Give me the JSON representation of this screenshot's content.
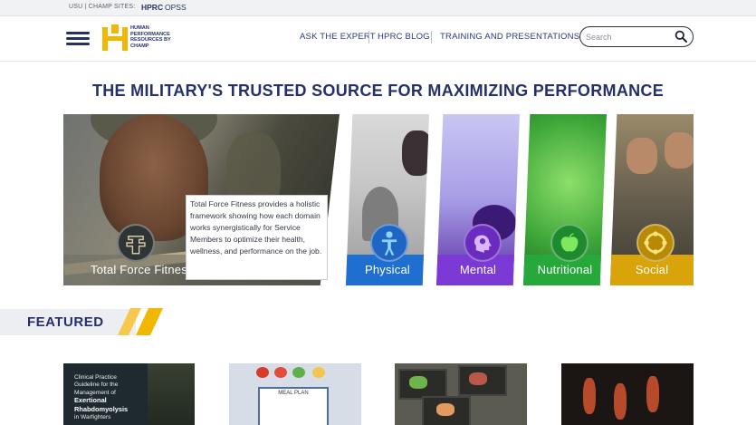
{
  "topbar": {
    "label": "USU | CHAMP SITES:",
    "links": [
      "HPRC",
      "OPSS"
    ]
  },
  "header": {
    "logo_text": "HUMAN PERFORMANCE RESOURCES BY CHAMP",
    "nav": [
      "ASK THE EXPERT",
      "HPRC BLOG",
      "TRAINING AND PRESENTATIONS"
    ],
    "search_placeholder": "Search"
  },
  "headline": "THE MILITARY'S TRUSTED SOURCE FOR MAXIMIZING PERFORMANCE",
  "hero": {
    "main_label": "Total Force Fitness",
    "tooltip": "Total Force Fitness provides a holistic framework showing how each domain works synergistically for Service Members to optimize their health, wellness, and performance on the job.",
    "tiles": [
      {
        "label": "Physical",
        "icon": "person-icon"
      },
      {
        "label": "Mental",
        "icon": "head-gear-icon"
      },
      {
        "label": "Nutritional",
        "icon": "apple-icon"
      },
      {
        "label": "Social",
        "icon": "group-circle-icon"
      }
    ]
  },
  "featured": {
    "title": "FEATURED",
    "cards": [
      {
        "text_lines": [
          "Clinical Practice",
          "Guideline for the",
          "Management of"
        ],
        "bold_lines": [
          "Exertional",
          "Rhabdomyolysis"
        ],
        "tail": "in Warfighters"
      },
      {
        "board_title": "MEAL PLAN"
      },
      {},
      {}
    ]
  },
  "colors": {
    "navy": "#25306a",
    "physical": "#1f6fd1",
    "mental": "#7b3ad6",
    "nutritional": "#26a93a",
    "social": "#d9a40a",
    "logo_yellow": "#f2b705"
  }
}
